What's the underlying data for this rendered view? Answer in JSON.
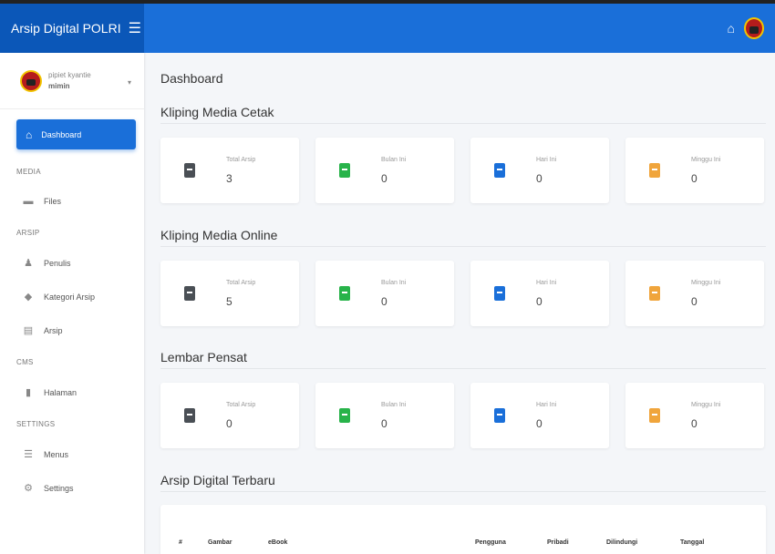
{
  "app": {
    "title": "Arsip Digital POLRI"
  },
  "user": {
    "name": "pipiet kyantie",
    "role": "mimin"
  },
  "sidebar": {
    "active": {
      "label": "Dashboard"
    },
    "sections": [
      {
        "heading": "MEDIA",
        "items": [
          {
            "label": "Files",
            "icon": "folder-icon"
          }
        ]
      },
      {
        "heading": "ARSIP",
        "items": [
          {
            "label": "Penulis",
            "icon": "users-icon"
          },
          {
            "label": "Kategori Arsip",
            "icon": "tags-icon"
          },
          {
            "label": "Arsip",
            "icon": "book-icon"
          }
        ]
      },
      {
        "heading": "CMS",
        "items": [
          {
            "label": "Halaman",
            "icon": "file-icon"
          }
        ]
      },
      {
        "heading": "SETTINGS",
        "items": [
          {
            "label": "Menus",
            "icon": "bars-icon"
          },
          {
            "label": "Settings",
            "icon": "cog-icon"
          }
        ]
      }
    ]
  },
  "main": {
    "page_title": "Dashboard",
    "stat_labels": [
      "Total Arsip",
      "Bulan Ini",
      "Hari Ini",
      "Minggu Ini"
    ],
    "colors": {
      "total": "#4a4f55",
      "bulan": "#28b34a",
      "hari": "#1a6fd9",
      "minggu": "#f0a53c"
    },
    "groups": [
      {
        "title": "Kliping Media Cetak",
        "values": [
          "3",
          "0",
          "0",
          "0"
        ]
      },
      {
        "title": "Kliping Media Online",
        "values": [
          "5",
          "0",
          "0",
          "0"
        ]
      },
      {
        "title": "Lembar Pensat",
        "values": [
          "0",
          "0",
          "0",
          "0"
        ]
      }
    ],
    "latest": {
      "title": "Arsip Digital Terbaru",
      "columns": [
        "#",
        "Gambar",
        "eBook",
        "Pengguna",
        "Pribadi",
        "Dilindungi",
        "Tanggal"
      ]
    }
  }
}
